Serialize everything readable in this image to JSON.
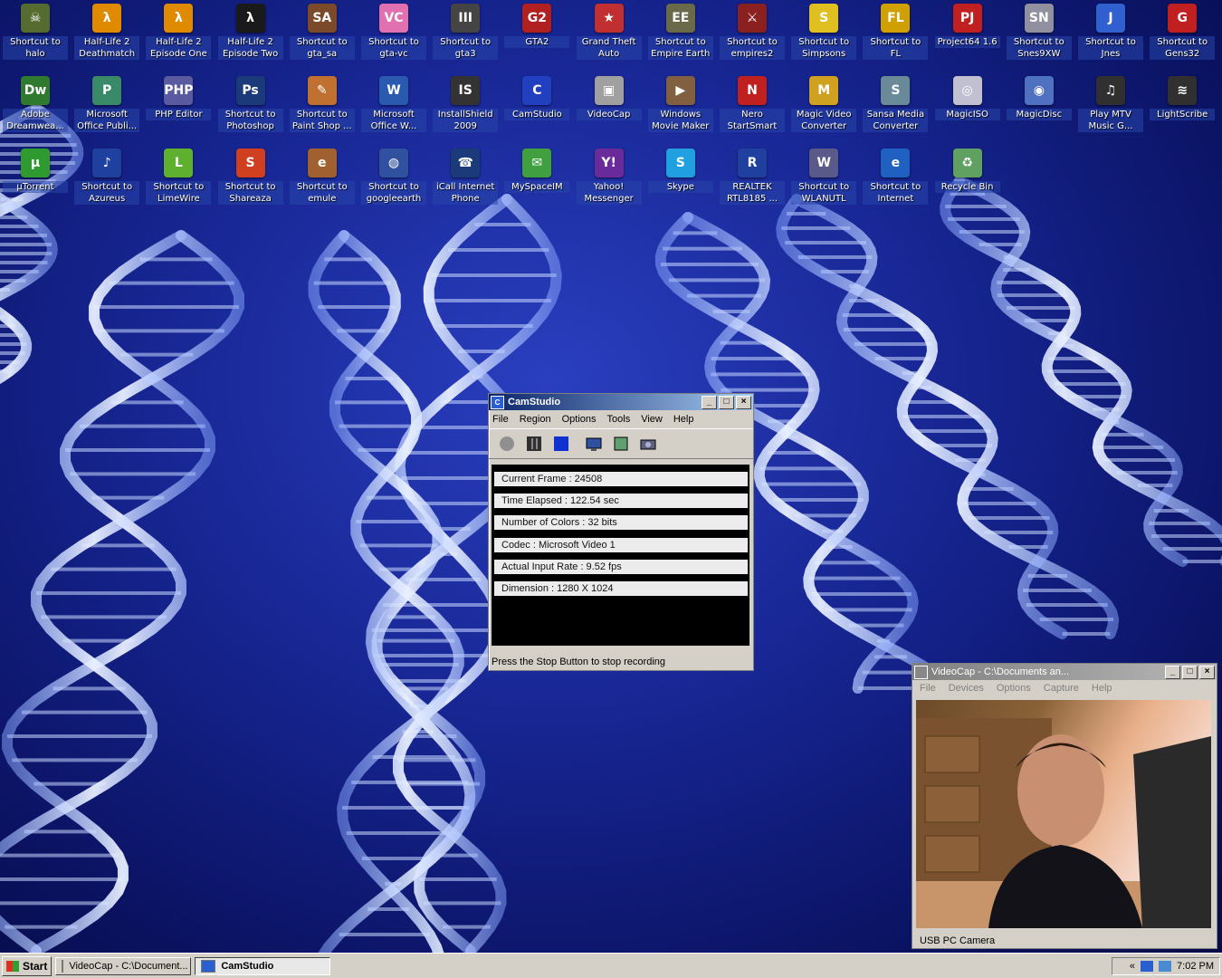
{
  "desktop": {
    "icons": [
      {
        "label": "Shortcut to\nhalo",
        "color": "#556b2f",
        "glyph": "☠"
      },
      {
        "label": "Half-Life 2\nDeathmatch",
        "color": "#e08a00",
        "glyph": "λ"
      },
      {
        "label": "Half-Life 2\nEpisode One",
        "color": "#e08a00",
        "glyph": "λ"
      },
      {
        "label": "Half-Life 2\nEpisode Two",
        "color": "#1a1a1a",
        "glyph": "λ"
      },
      {
        "label": "Shortcut to\ngta_sa",
        "color": "#7a4a2a",
        "glyph": "SA"
      },
      {
        "label": "Shortcut to\ngta-vc",
        "color": "#e070b0",
        "glyph": "VC"
      },
      {
        "label": "Shortcut to\ngta3",
        "color": "#444444",
        "glyph": "III"
      },
      {
        "label": "GTA2",
        "color": "#b02020",
        "glyph": "G2"
      },
      {
        "label": "Grand Theft\nAuto",
        "color": "#c03030",
        "glyph": "★"
      },
      {
        "label": "Shortcut to\nEmpire Earth",
        "color": "#6a6a4a",
        "glyph": "EE"
      },
      {
        "label": "Shortcut to\nempires2",
        "color": "#8a2020",
        "glyph": "⚔"
      },
      {
        "label": "Shortcut to\nSimpsons",
        "color": "#e0c020",
        "glyph": "S"
      },
      {
        "label": "Shortcut to FL",
        "color": "#d0a000",
        "glyph": "FL"
      },
      {
        "label": "Project64 1.6",
        "color": "#c02020",
        "glyph": "PJ"
      },
      {
        "label": "Shortcut to\nSnes9XW",
        "color": "#9090a0",
        "glyph": "SN"
      },
      {
        "label": "Shortcut to\nJnes",
        "color": "#3060d0",
        "glyph": "J"
      },
      {
        "label": "Shortcut to\nGens32",
        "color": "#c02020",
        "glyph": "G"
      },
      {
        "label": "Adobe\nDreamwea...",
        "color": "#2f7a2f",
        "glyph": "Dw"
      },
      {
        "label": "Microsoft\nOffice Publi...",
        "color": "#3a8a6a",
        "glyph": "P"
      },
      {
        "label": "PHP Editor",
        "color": "#5a5aa0",
        "glyph": "PHP"
      },
      {
        "label": "Shortcut to\nPhotoshop",
        "color": "#1a3a7a",
        "glyph": "Ps"
      },
      {
        "label": "Shortcut to\nPaint Shop ...",
        "color": "#c07030",
        "glyph": "✎"
      },
      {
        "label": "Microsoft\nOffice W...",
        "color": "#2a5ab0",
        "glyph": "W"
      },
      {
        "label": "InstallShield\n2009",
        "color": "#333333",
        "glyph": "IS"
      },
      {
        "label": "CamStudio",
        "color": "#2040c0",
        "glyph": "C"
      },
      {
        "label": "VideoCap",
        "color": "#a0a0a0",
        "glyph": "▣"
      },
      {
        "label": "Windows\nMovie Maker",
        "color": "#806040",
        "glyph": "▶"
      },
      {
        "label": "Nero\nStartSmart",
        "color": "#c02020",
        "glyph": "N"
      },
      {
        "label": "Magic Video\nConverter",
        "color": "#d0a020",
        "glyph": "M"
      },
      {
        "label": "Sansa Media\nConverter",
        "color": "#6a8a9a",
        "glyph": "S"
      },
      {
        "label": "MagicISO",
        "color": "#c0c0d0",
        "glyph": "◎"
      },
      {
        "label": "MagicDisc",
        "color": "#5070c0",
        "glyph": "◉"
      },
      {
        "label": "Play MTV\nMusic G...",
        "color": "#303030",
        "glyph": "♫"
      },
      {
        "label": "LightScribe",
        "color": "#303030",
        "glyph": "≋"
      },
      {
        "label": "µTorrent",
        "color": "#2f9a2f",
        "glyph": "µ"
      },
      {
        "label": "Shortcut to\nAzureus",
        "color": "#2040a0",
        "glyph": "♪"
      },
      {
        "label": "Shortcut to\nLimeWire",
        "color": "#60b030",
        "glyph": "L"
      },
      {
        "label": "Shortcut to\nShareaza",
        "color": "#d04020",
        "glyph": "S"
      },
      {
        "label": "Shortcut to\nemule",
        "color": "#a06030",
        "glyph": "e"
      },
      {
        "label": "Shortcut to\ngoogleearth",
        "color": "#3050a0",
        "glyph": "◍"
      },
      {
        "label": "iCall Internet\nPhone",
        "color": "#1a3a7a",
        "glyph": "☎"
      },
      {
        "label": "MySpaceIM",
        "color": "#40a040",
        "glyph": "✉"
      },
      {
        "label": "Yahoo!\nMessenger",
        "color": "#6a2a9a",
        "glyph": "Y!"
      },
      {
        "label": "Skype",
        "color": "#20a0e0",
        "glyph": "S"
      },
      {
        "label": "REALTEK\nRTL8185 ...",
        "color": "#2040a0",
        "glyph": "R"
      },
      {
        "label": "Shortcut to\nWLANUTL",
        "color": "#5a5a8a",
        "glyph": "W"
      },
      {
        "label": "Shortcut to\nInternet",
        "color": "#2060c0",
        "glyph": "e"
      },
      {
        "label": "Recycle Bin",
        "color": "#60a060",
        "glyph": "♻"
      }
    ]
  },
  "camstudio": {
    "title": "CamStudio",
    "menu": [
      "File",
      "Region",
      "Options",
      "Tools",
      "View",
      "Help"
    ],
    "stats": [
      "Current Frame : 24508",
      "Time Elapsed : 122.54 sec",
      "Number of Colors : 32 bits",
      "Codec : Microsoft Video 1",
      "Actual Input Rate : 9.52 fps",
      "Dimension : 1280 X 1024"
    ],
    "status": "Press the Stop Button to stop recording"
  },
  "videocap": {
    "title": "VideoCap - C:\\Documents an...",
    "menu": [
      "File",
      "Devices",
      "Options",
      "Capture",
      "Help"
    ],
    "status": "USB PC Camera"
  },
  "taskbar": {
    "start_label": "Start",
    "tasks": [
      {
        "label": "VideoCap - C:\\Document..."
      },
      {
        "label": "CamStudio"
      }
    ],
    "clock": "7:02 PM"
  }
}
